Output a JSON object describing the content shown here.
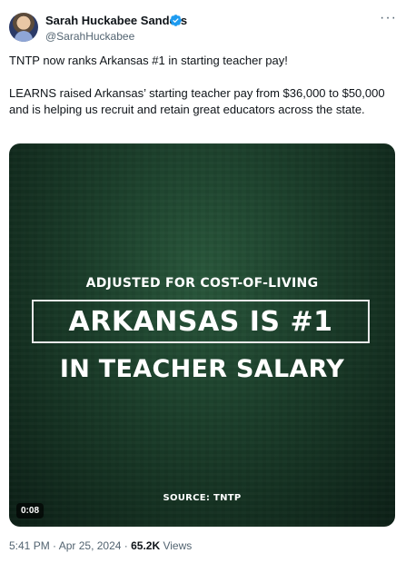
{
  "author": {
    "name": "Sarah Huckabee Sanders",
    "handle": "@SarahHuckabee",
    "verified": true,
    "verified_badge_color": "#1d9bf0"
  },
  "more_menu_label": "···",
  "tweet": {
    "paragraph_1": "TNTP now ranks Arkansas #1 in starting teacher pay!",
    "paragraph_2": "LEARNS raised Arkansas’ starting teacher pay from $36,000 to $50,000 and is helping us recruit and retain great educators across the state."
  },
  "media": {
    "line_1": "ADJUSTED FOR COST-OF-LIVING",
    "line_2": "ARKANSAS IS #1",
    "line_3": "IN TEACHER SALARY",
    "source": "SOURCE: TNTP",
    "duration": "0:08"
  },
  "meta": {
    "time": "5:41 PM",
    "separator": " · ",
    "date": "Apr 25, 2024",
    "views_count": "65.2K",
    "views_label": " Views"
  }
}
